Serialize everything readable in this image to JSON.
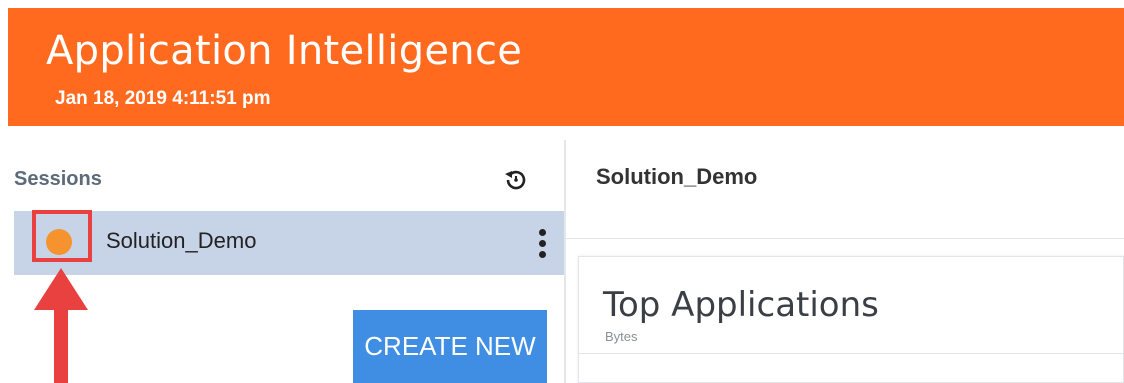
{
  "header": {
    "title": "Application Intelligence",
    "timestamp": "Jan 18, 2019 4:11:51 pm"
  },
  "sidebar": {
    "sessions_label": "Sessions",
    "history_icon": "history-icon",
    "sessions": [
      {
        "name": "Solution_Demo",
        "status_color": "#f7932e",
        "menu_icon": "kebab-menu-icon"
      }
    ],
    "create_button_label": "CREATE NEW"
  },
  "main": {
    "session_title": "Solution_Demo",
    "card": {
      "title": "Top Applications",
      "subtitle": "Bytes"
    }
  },
  "annotations": {
    "highlight_color": "#e8413f"
  },
  "colors": {
    "header_bg": "#ff6a1f",
    "selected_row_bg": "#c7d4e8",
    "button_bg": "#3f8ee4"
  }
}
